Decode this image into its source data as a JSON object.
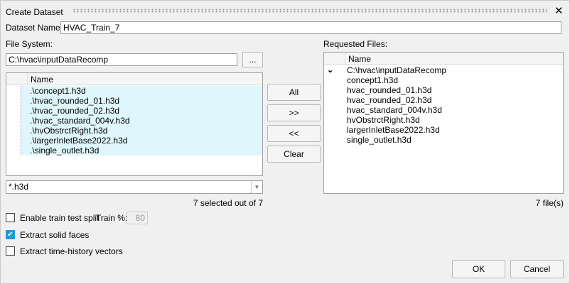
{
  "title": "Create Dataset",
  "dataset_name_label": "Dataset Name:",
  "dataset_name_value": "HVAC_Train_7",
  "file_system_label": "File System:",
  "path_value": "C:\\hvac\\inputDataRecomp",
  "browse_label": "...",
  "left_list": {
    "header": "Name",
    "items": [
      ".\\concept1.h3d",
      ".\\hvac_rounded_01.h3d",
      ".\\hvac_rounded_02.h3d",
      ".\\hvac_standard_004v.h3d",
      ".\\hvObstrctRight.h3d",
      ".\\largerInletBase2022.h3d",
      ".\\single_outlet.h3d"
    ]
  },
  "filter_value": "*.h3d",
  "selected_status": "7 selected out of 7",
  "buttons": {
    "all": "All",
    "add": ">>",
    "remove": "<<",
    "clear": "Clear",
    "ok": "OK",
    "cancel": "Cancel"
  },
  "options": {
    "train_split": "Enable train test split",
    "train_pct_label": "Train %:",
    "train_pct_value": "80",
    "solid_faces": "Extract solid faces",
    "time_history": "Extract time-history vectors"
  },
  "requested_label": "Requested Files:",
  "right_list": {
    "header": "Name",
    "root": "C:\\hvac\\inputDataRecomp",
    "items": [
      "concept1.h3d",
      "hvac_rounded_01.h3d",
      "hvac_rounded_02.h3d",
      "hvac_standard_004v.h3d",
      "hvObstrctRight.h3d",
      "largerInletBase2022.h3d",
      "single_outlet.h3d"
    ]
  },
  "file_count": "7 file(s)",
  "colors": {
    "selection": "#e0f6fd",
    "check": "#1e9ad6"
  }
}
